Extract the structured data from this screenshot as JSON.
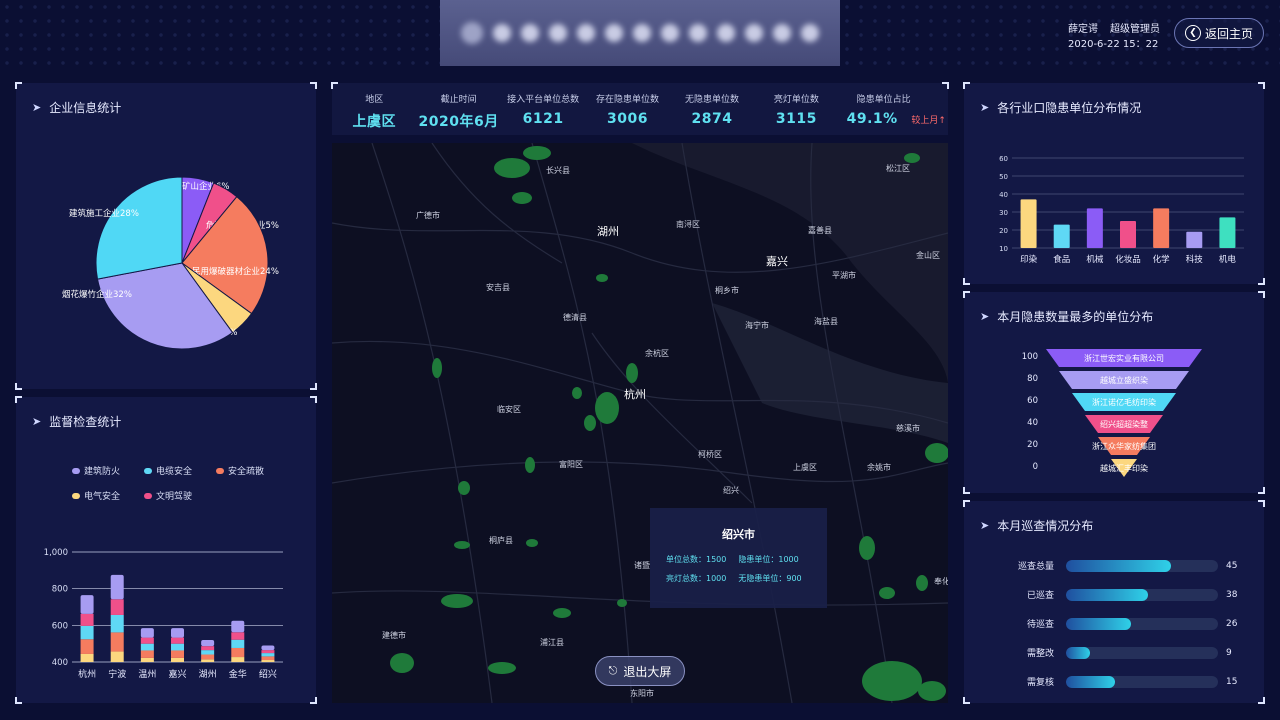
{
  "header": {
    "user_name": "薛定谔",
    "user_role": "超级管理员",
    "datetime": "2020-6-22   15：22",
    "home_button": "返回主页"
  },
  "stats": [
    {
      "label": "地区",
      "value": "上虞区"
    },
    {
      "label": "截止时间",
      "value": "2020年6月"
    },
    {
      "label": "接入平台单位总数",
      "value": "6121"
    },
    {
      "label": "存在隐患单位数",
      "value": "3006"
    },
    {
      "label": "无隐患单位数",
      "value": "2874"
    },
    {
      "label": "亮灯单位数",
      "value": "3115"
    },
    {
      "label": "隐患单位占比",
      "value": "49.1%",
      "sub": "较上月↑"
    }
  ],
  "panels": {
    "enterprise": {
      "title": "企业信息统计"
    },
    "supervision": {
      "title": "监督检查统计"
    },
    "industry": {
      "title": "各行业口隐患单位分布情况"
    },
    "top_units": {
      "title": "本月隐患数量最多的单位分布"
    },
    "patrol": {
      "title": "本月巡查情况分布"
    }
  },
  "enterprise_pie": {
    "chart_data": {
      "type": "pie",
      "slices": [
        {
          "label": "矿山企业6%",
          "value": 6,
          "color": "#8b5cf6"
        },
        {
          "label": "危险化学品企业5%",
          "value": 5,
          "color": "#f0508a"
        },
        {
          "label": "民用爆破器材企业24%",
          "value": 24,
          "color": "#f57c5f"
        },
        {
          "label": "其他企业5%",
          "value": 5,
          "color": "#fcd77f"
        },
        {
          "label": "烟花爆竹企业32%",
          "value": 32,
          "color": "#a79cf2"
        },
        {
          "label": "建筑施工企业28%",
          "value": 28,
          "color": "#50d8f5"
        }
      ]
    }
  },
  "supervision_chart": {
    "legend": [
      {
        "label": "建筑防火",
        "color": "#a79cf2"
      },
      {
        "label": "电缆安全",
        "color": "#5fd8f5"
      },
      {
        "label": "安全疏散",
        "color": "#f57c5f"
      },
      {
        "label": "电气安全",
        "color": "#fcd77f"
      },
      {
        "label": "文明驾驶",
        "color": "#f0508a"
      }
    ],
    "chart_data": {
      "type": "bar",
      "stacked": true,
      "categories": [
        "杭州",
        "宁波",
        "温州",
        "嘉兴",
        "湖州",
        "金华",
        "绍兴"
      ],
      "y_ticks": [
        "1,000",
        "800",
        "600",
        "400"
      ],
      "ylim": [
        400,
        1000
      ],
      "totals": [
        765,
        875,
        585,
        585,
        520,
        625,
        490
      ]
    }
  },
  "industry_chart": {
    "chart_data": {
      "type": "bar",
      "categories": [
        "印染",
        "食品",
        "机械",
        "化妆品",
        "化学",
        "科技",
        "机电"
      ],
      "values": [
        37,
        23,
        32,
        25,
        32,
        19,
        27
      ],
      "colors": [
        "#fcd77f",
        "#5fd8f5",
        "#8b5cf6",
        "#f0508a",
        "#f57c5f",
        "#a79cf2",
        "#3ee0c0"
      ],
      "ylim": [
        10,
        60
      ],
      "y_ticks": [
        "60",
        "50",
        "40",
        "30",
        "20",
        "10"
      ]
    }
  },
  "funnel": {
    "y_ticks": [
      "100",
      "80",
      "60",
      "40",
      "20",
      "0"
    ],
    "items": [
      {
        "label": "浙江世宏实业有限公司",
        "color": "#8b5cf6"
      },
      {
        "label": "越城立盛织染",
        "color": "#a79cf2"
      },
      {
        "label": "浙江诺亿毛纺印染",
        "color": "#50d8f5"
      },
      {
        "label": "绍兴超超染整",
        "color": "#f0508a"
      },
      {
        "label": "浙江众华家纺集团",
        "color": "#f57c5f"
      },
      {
        "label": "越城汇丰印染",
        "color": "#fcd77f"
      }
    ]
  },
  "patrol": {
    "items": [
      {
        "label": "巡查总量",
        "value": "45",
        "ratio": 0.69
      },
      {
        "label": "已巡查",
        "value": "38",
        "ratio": 0.54
      },
      {
        "label": "待巡查",
        "value": "26",
        "ratio": 0.43
      },
      {
        "label": "需整改",
        "value": "9",
        "ratio": 0.16
      },
      {
        "label": "需复核",
        "value": "15",
        "ratio": 0.32
      }
    ]
  },
  "map": {
    "labels": [
      "长兴县",
      "广德市",
      "湖州",
      "南浔区",
      "嘉善县",
      "松江区",
      "嘉兴",
      "平湖市",
      "金山区",
      "安吉县",
      "桐乡市",
      "德清县",
      "海宁市",
      "海盐县",
      "余杭区",
      "杭州",
      "临安区",
      "慈溪市",
      "富阳区",
      "柯桥区",
      "上虞区",
      "余姚市",
      "绍兴",
      "桐庐县",
      "诸暨",
      "建德市",
      "浦江县",
      "东阳市",
      "奉化"
    ],
    "popup": {
      "title": "绍兴市",
      "row1_a": "单位总数：1500",
      "row1_b": "隐患单位：1000",
      "row2_a": "亮灯总数：1000",
      "row2_b": "无隐患单位：900"
    },
    "exit_button": "退出大屏"
  }
}
